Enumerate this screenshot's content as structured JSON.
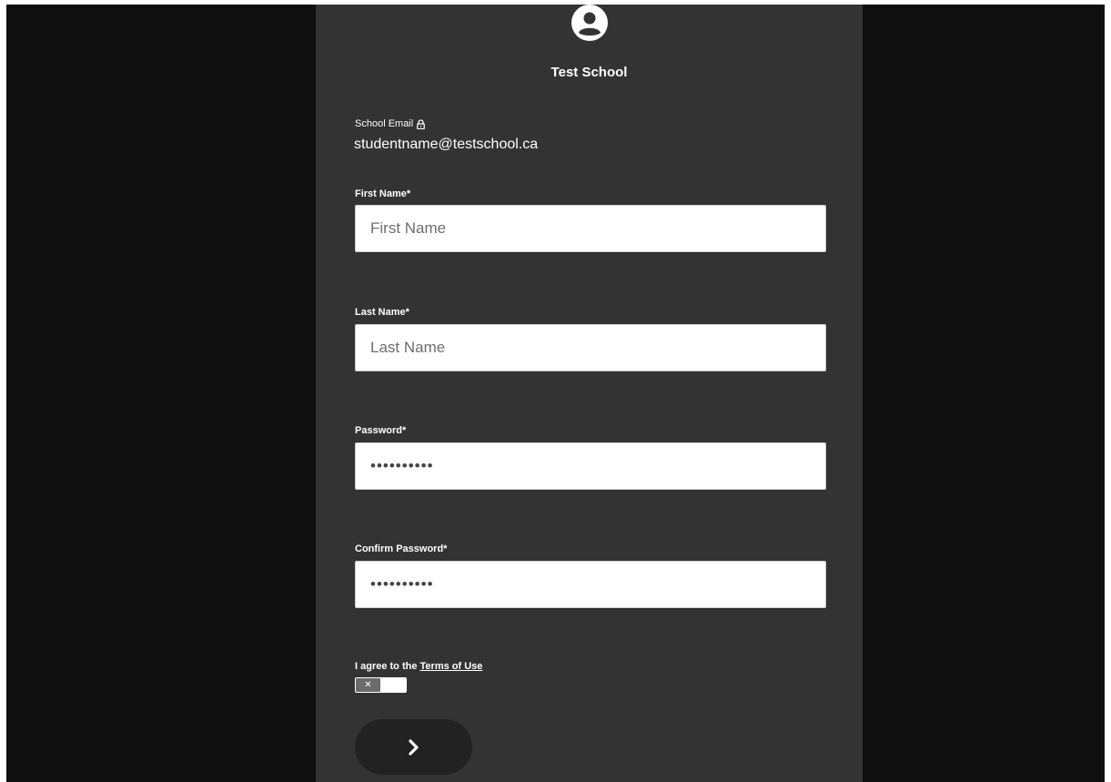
{
  "header": {
    "school_name": "Test School",
    "avatar_icon": "user-circle-icon"
  },
  "email": {
    "label": "School Email",
    "lock_icon": "lock-icon",
    "value": "studentname@testschool.ca"
  },
  "fields": {
    "first_name": {
      "label": "First Name*",
      "placeholder": "First Name",
      "value": ""
    },
    "last_name": {
      "label": "Last Name*",
      "placeholder": "Last Name",
      "value": ""
    },
    "password": {
      "label": "Password*",
      "value": "••••••••••"
    },
    "confirm_password": {
      "label": "Confirm Password*",
      "value": "••••••••••"
    }
  },
  "terms": {
    "prefix": "I agree to the ",
    "link_text": "Terms of Use",
    "toggle_state": "off",
    "toggle_glyph": "✕"
  },
  "submit": {
    "icon": "chevron-right-icon"
  },
  "colors": {
    "background": "#0f0f0f",
    "panel": "#333333",
    "button": "#222222"
  }
}
